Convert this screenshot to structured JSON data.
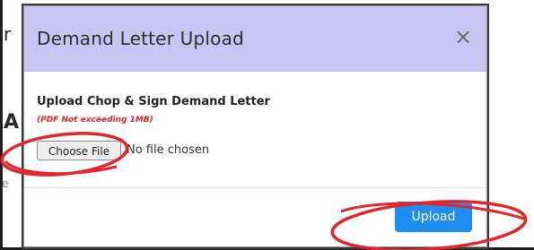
{
  "dialog": {
    "title": "Demand Letter Upload",
    "close_symbol": "×"
  },
  "form": {
    "label": "Upload Chop & Sign Demand Letter",
    "hint": "(PDF Not exceeding 1MB)",
    "choose_file_label": "Choose File",
    "file_status": "No file chosen"
  },
  "footer": {
    "upload_label": "Upload"
  },
  "background": {
    "glyph_1": "r",
    "glyph_2": "A",
    "glyph_3": "e"
  },
  "colors": {
    "header_bg": "#c9c5f3",
    "hint": "#e8262b",
    "upload_button": "#1e8ef0",
    "annotation": "#e3262b"
  },
  "icons": {
    "close": "close-icon"
  }
}
